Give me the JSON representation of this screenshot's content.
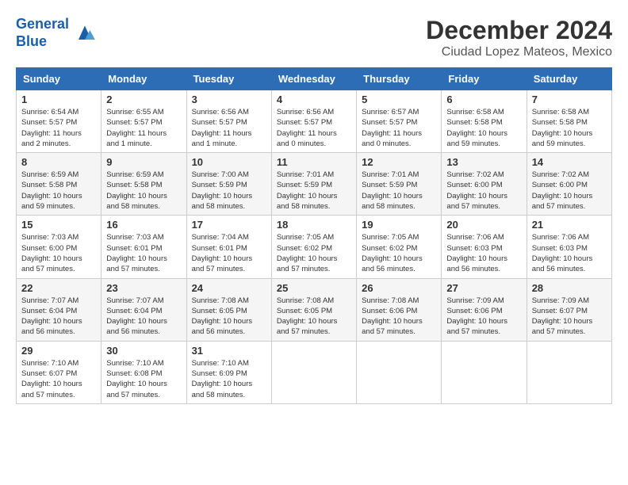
{
  "header": {
    "logo_line1": "General",
    "logo_line2": "Blue",
    "month": "December 2024",
    "location": "Ciudad Lopez Mateos, Mexico"
  },
  "days_of_week": [
    "Sunday",
    "Monday",
    "Tuesday",
    "Wednesday",
    "Thursday",
    "Friday",
    "Saturday"
  ],
  "weeks": [
    [
      {
        "day": "1",
        "sunrise": "6:54 AM",
        "sunset": "5:57 PM",
        "daylight": "11 hours and 2 minutes."
      },
      {
        "day": "2",
        "sunrise": "6:55 AM",
        "sunset": "5:57 PM",
        "daylight": "11 hours and 1 minute."
      },
      {
        "day": "3",
        "sunrise": "6:56 AM",
        "sunset": "5:57 PM",
        "daylight": "11 hours and 1 minute."
      },
      {
        "day": "4",
        "sunrise": "6:56 AM",
        "sunset": "5:57 PM",
        "daylight": "11 hours and 0 minutes."
      },
      {
        "day": "5",
        "sunrise": "6:57 AM",
        "sunset": "5:57 PM",
        "daylight": "11 hours and 0 minutes."
      },
      {
        "day": "6",
        "sunrise": "6:58 AM",
        "sunset": "5:58 PM",
        "daylight": "10 hours and 59 minutes."
      },
      {
        "day": "7",
        "sunrise": "6:58 AM",
        "sunset": "5:58 PM",
        "daylight": "10 hours and 59 minutes."
      }
    ],
    [
      {
        "day": "8",
        "sunrise": "6:59 AM",
        "sunset": "5:58 PM",
        "daylight": "10 hours and 59 minutes."
      },
      {
        "day": "9",
        "sunrise": "6:59 AM",
        "sunset": "5:58 PM",
        "daylight": "10 hours and 58 minutes."
      },
      {
        "day": "10",
        "sunrise": "7:00 AM",
        "sunset": "5:59 PM",
        "daylight": "10 hours and 58 minutes."
      },
      {
        "day": "11",
        "sunrise": "7:01 AM",
        "sunset": "5:59 PM",
        "daylight": "10 hours and 58 minutes."
      },
      {
        "day": "12",
        "sunrise": "7:01 AM",
        "sunset": "5:59 PM",
        "daylight": "10 hours and 58 minutes."
      },
      {
        "day": "13",
        "sunrise": "7:02 AM",
        "sunset": "6:00 PM",
        "daylight": "10 hours and 57 minutes."
      },
      {
        "day": "14",
        "sunrise": "7:02 AM",
        "sunset": "6:00 PM",
        "daylight": "10 hours and 57 minutes."
      }
    ],
    [
      {
        "day": "15",
        "sunrise": "7:03 AM",
        "sunset": "6:00 PM",
        "daylight": "10 hours and 57 minutes."
      },
      {
        "day": "16",
        "sunrise": "7:03 AM",
        "sunset": "6:01 PM",
        "daylight": "10 hours and 57 minutes."
      },
      {
        "day": "17",
        "sunrise": "7:04 AM",
        "sunset": "6:01 PM",
        "daylight": "10 hours and 57 minutes."
      },
      {
        "day": "18",
        "sunrise": "7:05 AM",
        "sunset": "6:02 PM",
        "daylight": "10 hours and 57 minutes."
      },
      {
        "day": "19",
        "sunrise": "7:05 AM",
        "sunset": "6:02 PM",
        "daylight": "10 hours and 56 minutes."
      },
      {
        "day": "20",
        "sunrise": "7:06 AM",
        "sunset": "6:03 PM",
        "daylight": "10 hours and 56 minutes."
      },
      {
        "day": "21",
        "sunrise": "7:06 AM",
        "sunset": "6:03 PM",
        "daylight": "10 hours and 56 minutes."
      }
    ],
    [
      {
        "day": "22",
        "sunrise": "7:07 AM",
        "sunset": "6:04 PM",
        "daylight": "10 hours and 56 minutes."
      },
      {
        "day": "23",
        "sunrise": "7:07 AM",
        "sunset": "6:04 PM",
        "daylight": "10 hours and 56 minutes."
      },
      {
        "day": "24",
        "sunrise": "7:08 AM",
        "sunset": "6:05 PM",
        "daylight": "10 hours and 56 minutes."
      },
      {
        "day": "25",
        "sunrise": "7:08 AM",
        "sunset": "6:05 PM",
        "daylight": "10 hours and 57 minutes."
      },
      {
        "day": "26",
        "sunrise": "7:08 AM",
        "sunset": "6:06 PM",
        "daylight": "10 hours and 57 minutes."
      },
      {
        "day": "27",
        "sunrise": "7:09 AM",
        "sunset": "6:06 PM",
        "daylight": "10 hours and 57 minutes."
      },
      {
        "day": "28",
        "sunrise": "7:09 AM",
        "sunset": "6:07 PM",
        "daylight": "10 hours and 57 minutes."
      }
    ],
    [
      {
        "day": "29",
        "sunrise": "7:10 AM",
        "sunset": "6:07 PM",
        "daylight": "10 hours and 57 minutes."
      },
      {
        "day": "30",
        "sunrise": "7:10 AM",
        "sunset": "6:08 PM",
        "daylight": "10 hours and 57 minutes."
      },
      {
        "day": "31",
        "sunrise": "7:10 AM",
        "sunset": "6:09 PM",
        "daylight": "10 hours and 58 minutes."
      },
      null,
      null,
      null,
      null
    ]
  ]
}
